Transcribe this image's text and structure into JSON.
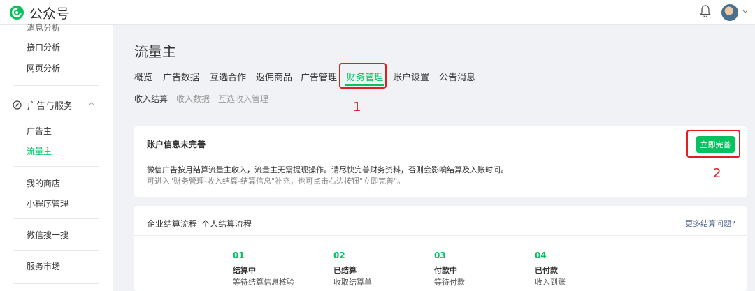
{
  "app": {
    "name": "公众号"
  },
  "sidebar": {
    "cut_item": "消息分析",
    "items": [
      {
        "label": "接口分析"
      },
      {
        "label": "网页分析"
      }
    ],
    "section": {
      "label": "广告与服务"
    },
    "section_items": [
      {
        "label": "广告主"
      },
      {
        "label": "流量主"
      }
    ],
    "more_items": [
      {
        "label": "我的商店"
      },
      {
        "label": "小程序管理"
      },
      {
        "label": "微信搜一搜"
      },
      {
        "label": "服务市场"
      }
    ]
  },
  "page": {
    "title": "流量主"
  },
  "tabs": [
    {
      "label": "概览"
    },
    {
      "label": "广告数据"
    },
    {
      "label": "互选合作"
    },
    {
      "label": "返佣商品"
    },
    {
      "label": "广告管理"
    },
    {
      "label": "财务管理"
    },
    {
      "label": "账户设置"
    },
    {
      "label": "公告消息"
    }
  ],
  "subtabs": [
    {
      "label": "收入结算"
    },
    {
      "label": "收入数据"
    },
    {
      "label": "互选收入管理"
    }
  ],
  "annotations": {
    "one": "1",
    "two": "2"
  },
  "notice": {
    "title": "账户信息未完善",
    "line1": "微信广告按月结算流量主收入，流量主无需提现操作。请尽快完善财务资料，否则会影响结算及入账时间。",
    "line2": "可进入\"财务管理-收入结算-结算信息\"补充，也可点击右边按钮\"立即完善\"。",
    "button": "立即完善"
  },
  "flow": {
    "tabs": [
      {
        "label": "企业结算流程"
      },
      {
        "label": "个人结算流程"
      }
    ],
    "more_link": "更多结算问题?",
    "steps": [
      {
        "num": "01",
        "title": "结算中",
        "desc": "等待结算信息核验"
      },
      {
        "num": "02",
        "title": "已结算",
        "desc": "收取结算单"
      },
      {
        "num": "03",
        "title": "付款中",
        "desc": "等待付款"
      },
      {
        "num": "04",
        "title": "已付款",
        "desc": "收入到账"
      }
    ]
  },
  "colors": {
    "accent": "#07c160",
    "annotation": "#e02020",
    "link": "#576b95"
  }
}
